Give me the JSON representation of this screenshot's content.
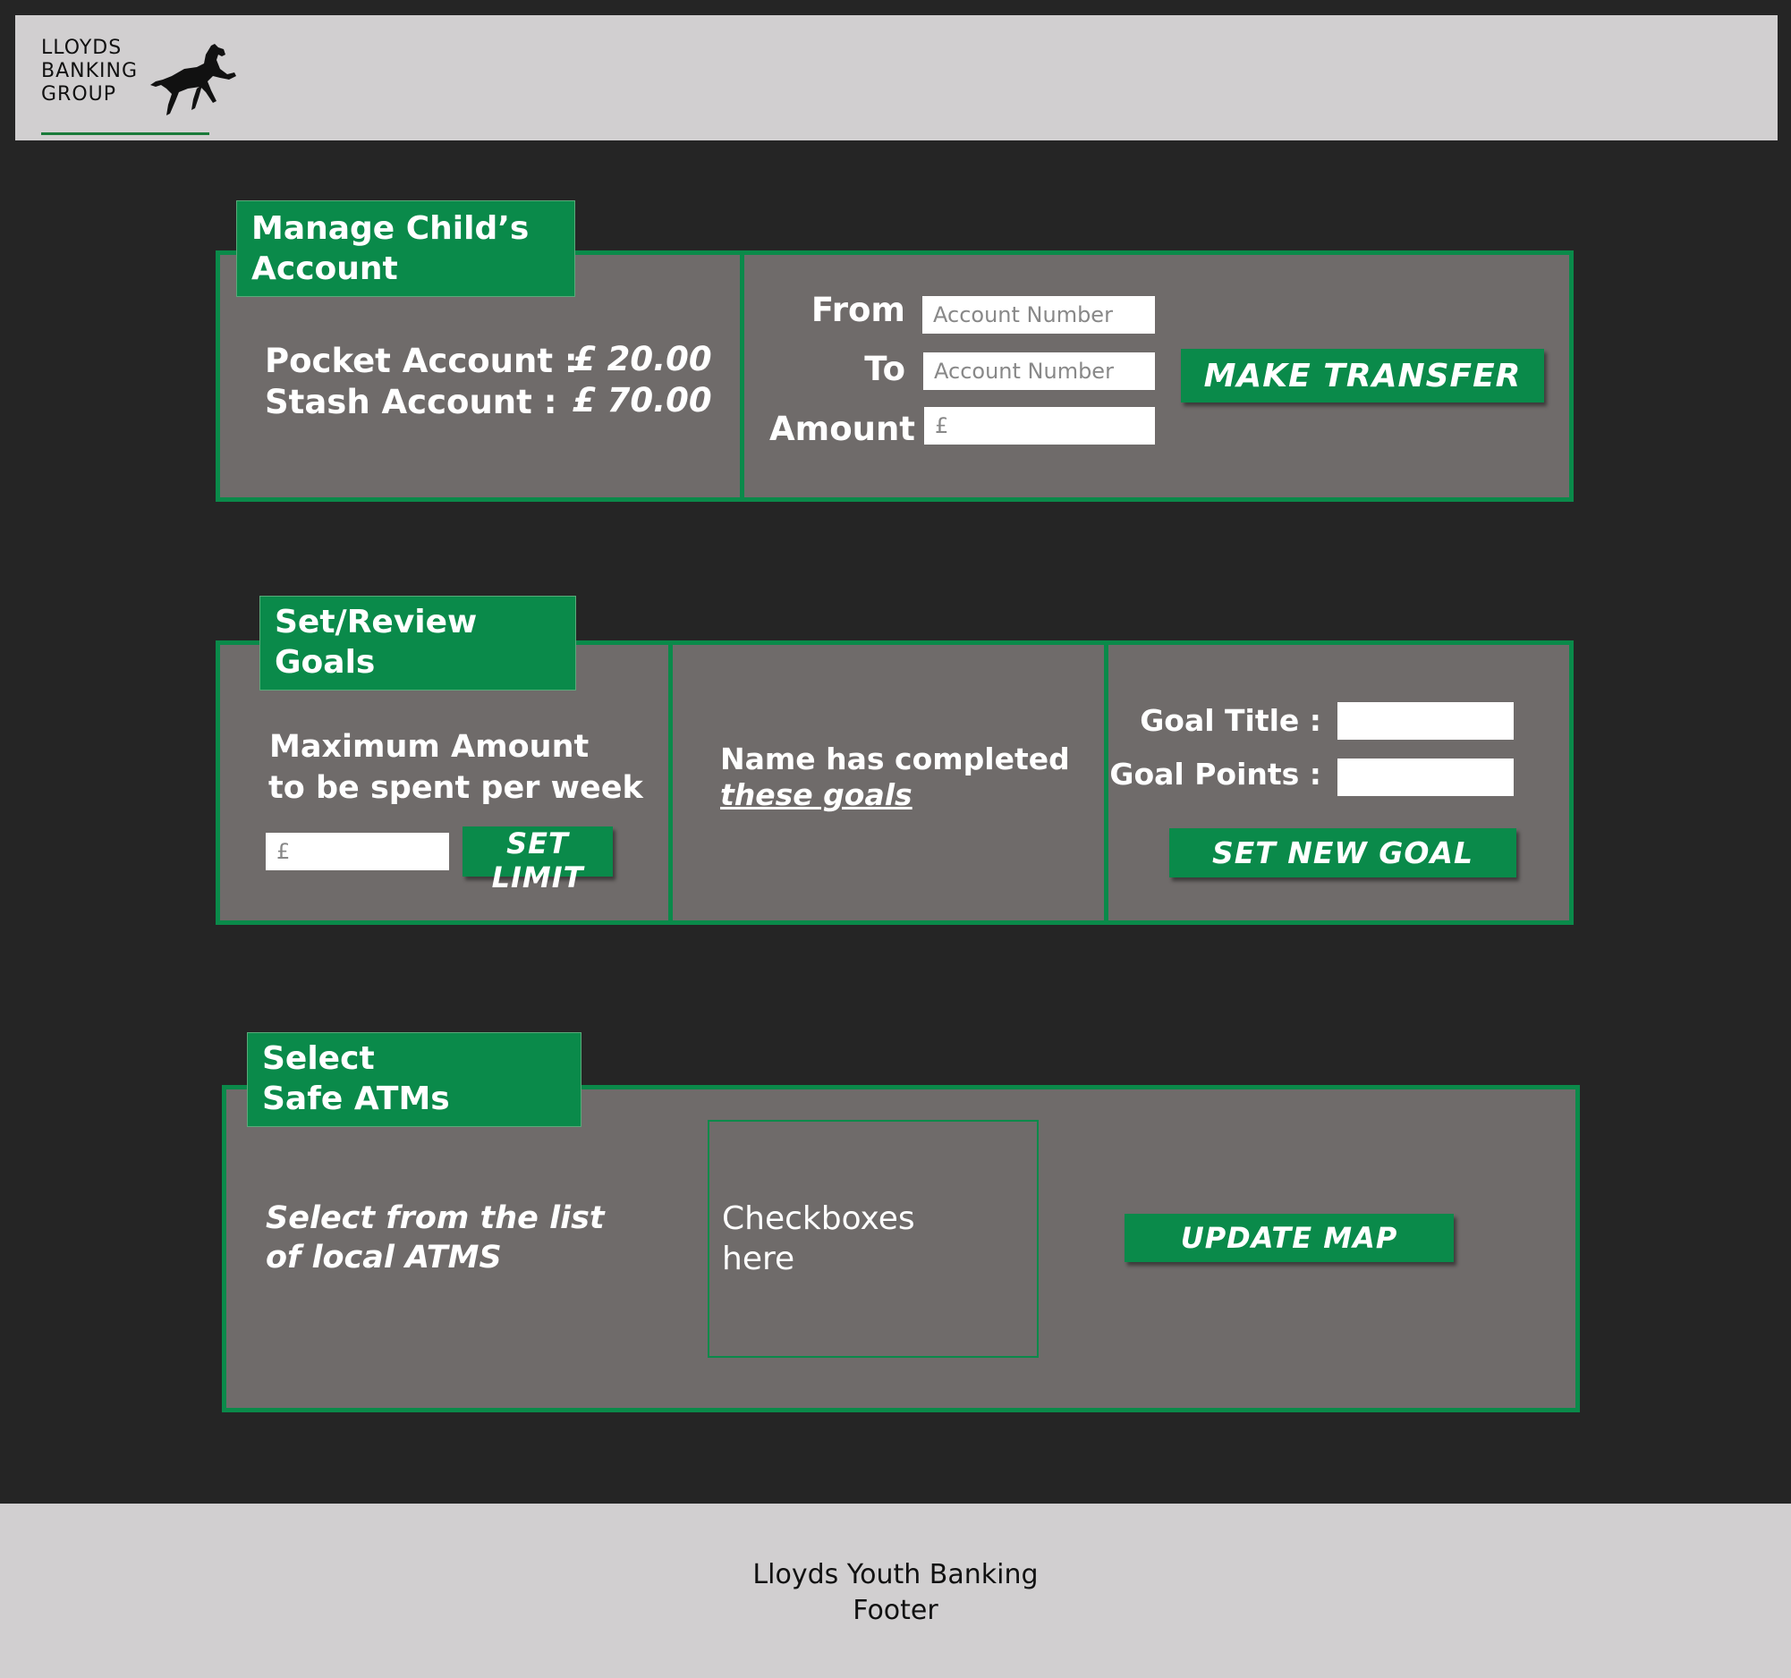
{
  "header": {
    "logo_lines": [
      "LLOYDS",
      "BANKING",
      "GROUP"
    ]
  },
  "manage": {
    "tag_lines": [
      "Manage Child’s",
      "Account"
    ],
    "pocket_label": "Pocket Account :",
    "pocket_value": "£ 20.00",
    "stash_label": "Stash Account :",
    "stash_value": "£ 70.00",
    "from_label": "From",
    "to_label": "To",
    "amount_label": "Amount",
    "from_placeholder": "Account Number",
    "to_placeholder": "Account Number",
    "amount_placeholder": "£",
    "transfer_button": "MAKE TRANSFER"
  },
  "goals": {
    "tag_lines": [
      "Set/Review",
      "Goals"
    ],
    "max_line1": "Maximum Amount",
    "max_line2": "to be spent per week",
    "limit_placeholder": "£",
    "set_limit_button": "SET LIMIT",
    "completed_text": "Name has completed",
    "completed_link": "these goals",
    "goal_title_label": "Goal Title :",
    "goal_points_label": "Goal Points :",
    "set_goal_button": "SET NEW GOAL"
  },
  "atms": {
    "tag_lines": [
      "Select",
      "Safe ATMs"
    ],
    "select_line1": "Select from the list",
    "select_line2": "of local ATMS",
    "checkbox_line1": "Checkboxes",
    "checkbox_line2": "here",
    "update_button": "UPDATE MAP"
  },
  "footer": {
    "line1": "Lloyds Youth Banking",
    "line2": "Footer"
  },
  "colors": {
    "accent": "#0a8a4a",
    "panel": "#6f6b6a",
    "background": "#252525",
    "header": "#d1cfd0"
  }
}
